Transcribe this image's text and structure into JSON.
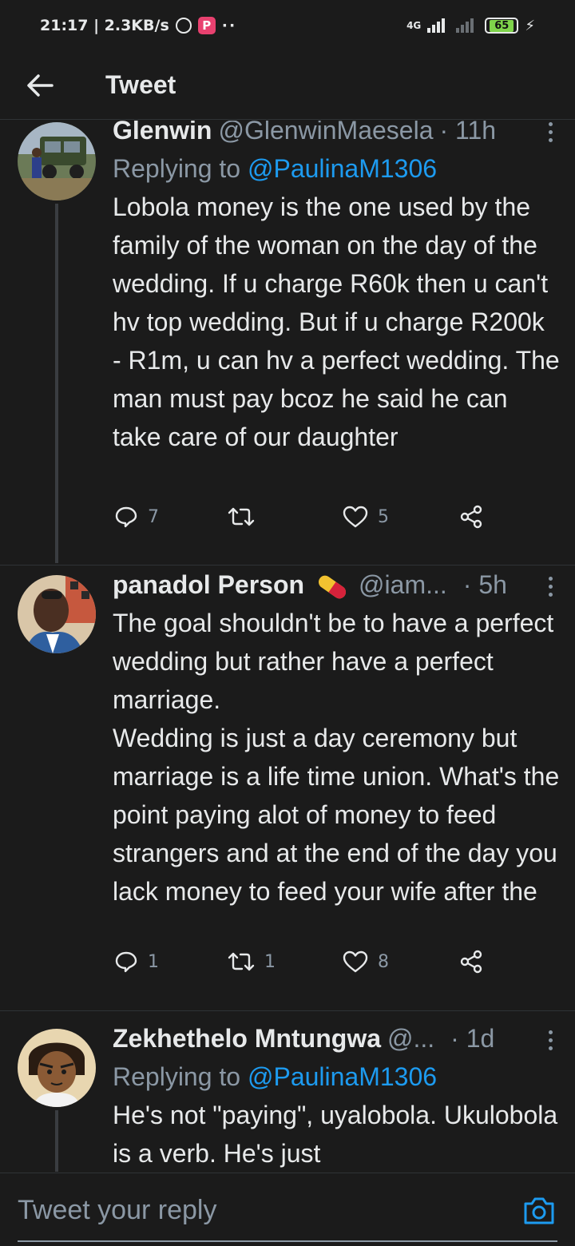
{
  "status_bar": {
    "time_speed": "21:17 | 2.3KB/s",
    "network": "4G",
    "battery": "65"
  },
  "header": {
    "title": "Tweet"
  },
  "tweets": [
    {
      "name": "Glenwin",
      "handle": "@GlenwinMaesela",
      "time": "· 11h",
      "replying_label": "Replying to",
      "replying_to": "@PaulinaM1306",
      "text": "Lobola money is the one used by the family of the woman on the day of the wedding. If u charge R60k then u can't hv top wedding. But if u charge R200k - R1m, u can hv a perfect wedding. The man must pay bcoz he said he can take care of our daughter",
      "replies": "7",
      "retweets": "",
      "likes": "5"
    },
    {
      "name": "panadol Person",
      "handle": "@iam...",
      "time": "· 5h",
      "text": "The goal shouldn't be to have a perfect wedding but rather have a perfect marriage.\nWedding is just a day ceremony but marriage is a life time union. What's the point paying alot of money to feed strangers and at the end of the day you lack money to feed your wife after the",
      "replies": "1",
      "retweets": "1",
      "likes": "8"
    },
    {
      "name": "Zekhethelo Mntungwa",
      "handle": "@...",
      "time": "· 1d",
      "replying_label": "Replying to",
      "replying_to": "@PaulinaM1306",
      "text": "He's not \"paying\", uyalobola. Ukulobola is a verb. He's just"
    }
  ],
  "reply_bar": {
    "placeholder": "Tweet your reply"
  },
  "colors": {
    "background": "#1b1b1b",
    "text": "#e7e9ea",
    "muted": "#8b98a5",
    "link": "#1d9bf0"
  }
}
